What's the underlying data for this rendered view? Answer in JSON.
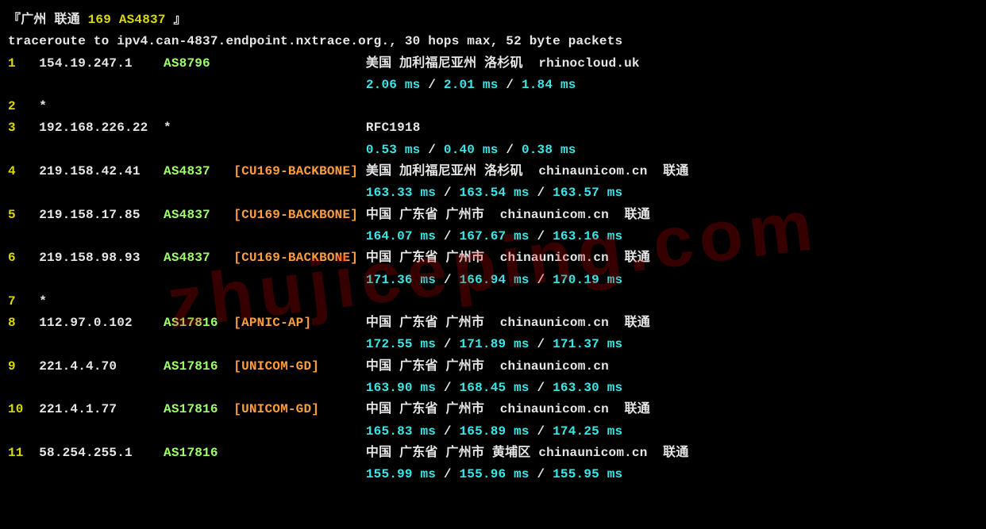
{
  "watermark": "zhujiceping.com",
  "header": {
    "bracket_open": "『",
    "loc": "广州 联通 ",
    "asn": "169 AS4837 ",
    "bracket_close": "』"
  },
  "trace_line": "traceroute to ipv4.can-4837.endpoint.nxtrace.org., 30 hops max, 52 byte packets",
  "hops": [
    {
      "n": "1",
      "ip": "154.19.247.1",
      "asn": "AS8796",
      "tag": "",
      "desc": "美国 加利福尼亚州 洛杉矶  rhinocloud.uk",
      "rtt": [
        "2.06 ms",
        "2.01 ms",
        "1.84 ms"
      ]
    },
    {
      "n": "2",
      "ip": "*",
      "asn": "",
      "tag": "",
      "desc": "",
      "rtt": []
    },
    {
      "n": "3",
      "ip": "192.168.226.22",
      "asn": "*",
      "tag": "",
      "desc": "RFC1918",
      "rtt": [
        "0.53 ms",
        "0.40 ms",
        "0.38 ms"
      ],
      "asn_plain": true,
      "desc_bold": true
    },
    {
      "n": "4",
      "ip": "219.158.42.41",
      "asn": "AS4837",
      "tag": "[CU169-BACKBONE]",
      "desc": "美国 加利福尼亚州 洛杉矶  chinaunicom.cn  联通",
      "rtt": [
        "163.33 ms",
        "163.54 ms",
        "163.57 ms"
      ]
    },
    {
      "n": "5",
      "ip": "219.158.17.85",
      "asn": "AS4837",
      "tag": "[CU169-BACKBONE]",
      "desc": "中国 广东省 广州市  chinaunicom.cn  联通",
      "rtt": [
        "164.07 ms",
        "167.67 ms",
        "163.16 ms"
      ]
    },
    {
      "n": "6",
      "ip": "219.158.98.93",
      "asn": "AS4837",
      "tag": "[CU169-BACKBONE]",
      "desc": "中国 广东省 广州市  chinaunicom.cn  联通",
      "rtt": [
        "171.36 ms",
        "166.94 ms",
        "170.19 ms"
      ]
    },
    {
      "n": "7",
      "ip": "*",
      "asn": "",
      "tag": "",
      "desc": "",
      "rtt": []
    },
    {
      "n": "8",
      "ip": "112.97.0.102",
      "asn": "AS17816",
      "tag": "[APNIC-AP]",
      "desc": "中国 广东省 广州市  chinaunicom.cn  联通",
      "rtt": [
        "172.55 ms",
        "171.89 ms",
        "171.37 ms"
      ]
    },
    {
      "n": "9",
      "ip": "221.4.4.70",
      "asn": "AS17816",
      "tag": "[UNICOM-GD]",
      "desc": "中国 广东省 广州市  chinaunicom.cn",
      "rtt": [
        "163.90 ms",
        "168.45 ms",
        "163.30 ms"
      ]
    },
    {
      "n": "10",
      "ip": "221.4.1.77",
      "asn": "AS17816",
      "tag": "[UNICOM-GD]",
      "desc": "中国 广东省 广州市  chinaunicom.cn  联通",
      "rtt": [
        "165.83 ms",
        "165.89 ms",
        "174.25 ms"
      ]
    },
    {
      "n": "11",
      "ip": "58.254.255.1",
      "asn": "AS17816",
      "tag": "",
      "desc": "中国 广东省 广州市 黄埔区 chinaunicom.cn  联通",
      "rtt": [
        "155.99 ms",
        "155.96 ms",
        "155.95 ms"
      ]
    }
  ]
}
